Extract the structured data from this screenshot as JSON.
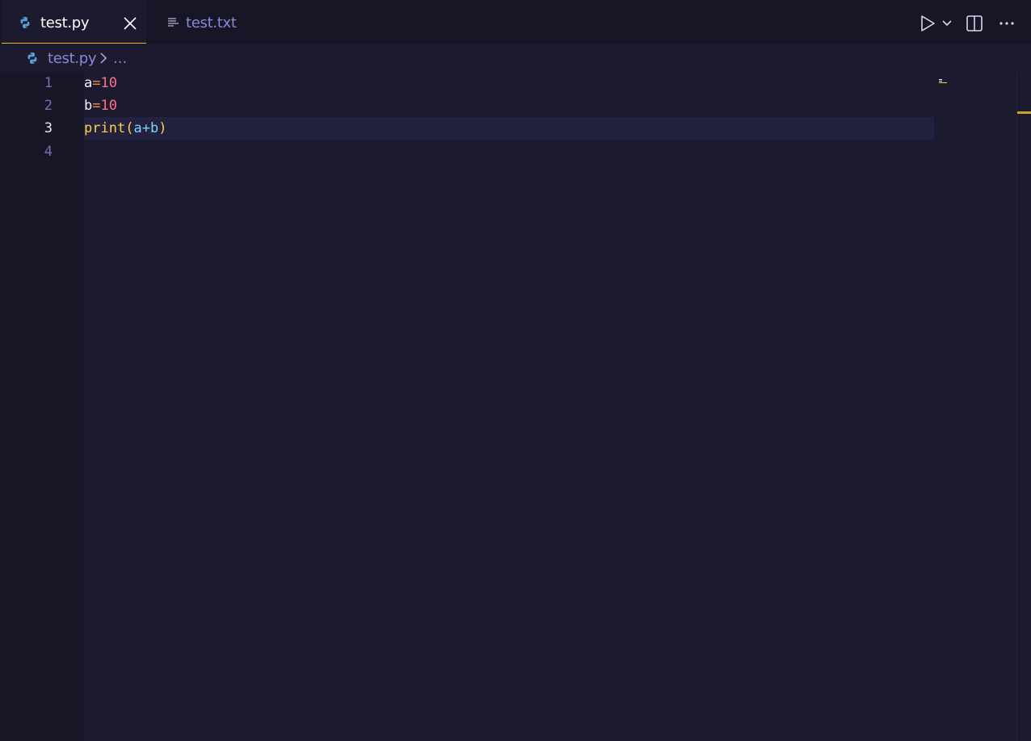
{
  "tabs": [
    {
      "label": "test.py",
      "icon": "python-icon",
      "active": true
    },
    {
      "label": "test.txt",
      "icon": "text-file-icon",
      "active": false
    }
  ],
  "toolbar": {
    "run_icon": "run-icon",
    "run_menu_icon": "chevron-down-icon",
    "split_icon": "split-editor-icon",
    "more_icon": "more-actions-icon"
  },
  "breadcrumb": {
    "file": "test.py",
    "more": "..."
  },
  "editor": {
    "current_line": 3,
    "lines": [
      {
        "number": "1",
        "tokens": [
          {
            "t": "a",
            "c": "tok-var"
          },
          {
            "t": "=",
            "c": "tok-op"
          },
          {
            "t": "10",
            "c": "tok-num"
          }
        ]
      },
      {
        "number": "2",
        "tokens": [
          {
            "t": "b",
            "c": "tok-var"
          },
          {
            "t": "=",
            "c": "tok-op"
          },
          {
            "t": "10",
            "c": "tok-num"
          }
        ]
      },
      {
        "number": "3",
        "tokens": [
          {
            "t": "print",
            "c": "tok-fn"
          },
          {
            "t": "(",
            "c": "tok-paren"
          },
          {
            "t": "a",
            "c": "tok-arg"
          },
          {
            "t": "+",
            "c": "tok-plus"
          },
          {
            "t": "b",
            "c": "tok-arg"
          },
          {
            "t": ")",
            "c": "tok-paren"
          }
        ]
      },
      {
        "number": "4",
        "tokens": []
      }
    ]
  },
  "colors": {
    "accent": "#e6b422",
    "background": "#1b1a2e",
    "tab_inactive_text": "#8e86d8"
  }
}
